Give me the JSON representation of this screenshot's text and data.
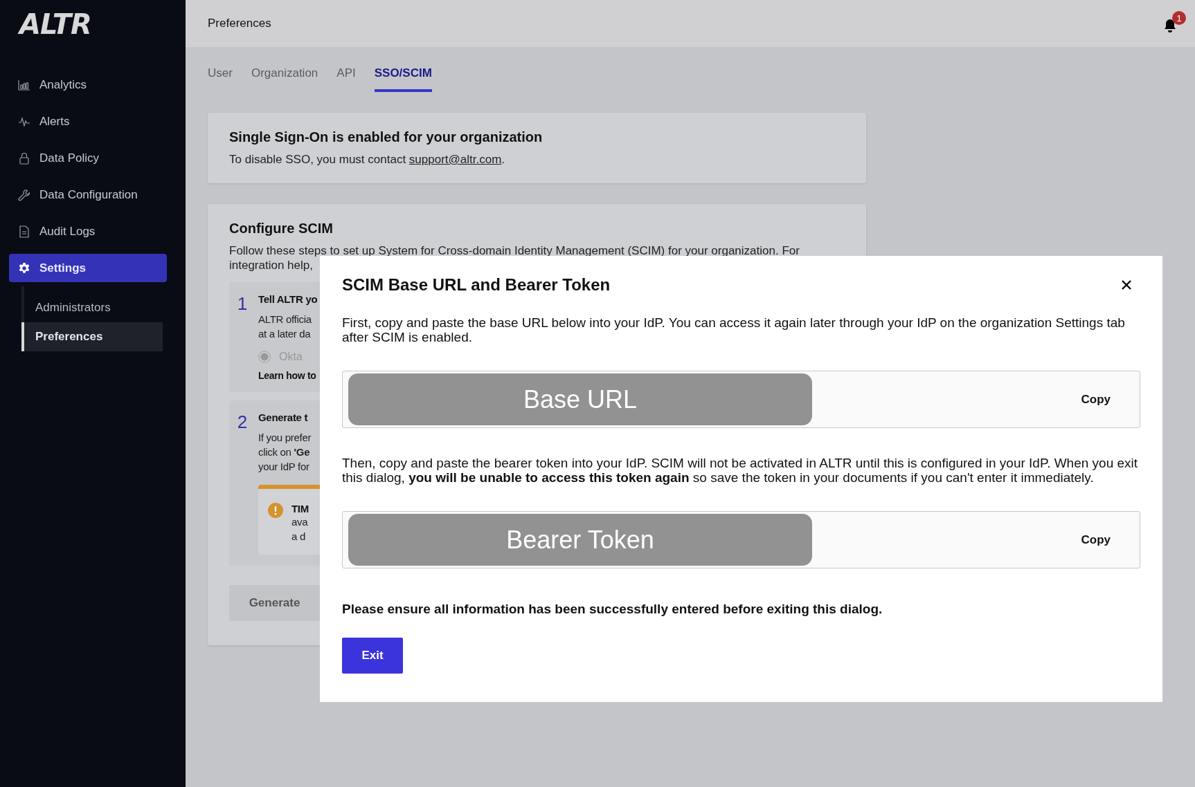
{
  "sidebar": {
    "logo": "ALTR",
    "items": [
      {
        "label": "Analytics",
        "selected": false
      },
      {
        "label": "Alerts",
        "selected": false
      },
      {
        "label": "Data Policy",
        "selected": false
      },
      {
        "label": "Data Configuration",
        "selected": false
      },
      {
        "label": "Audit Logs",
        "selected": false
      },
      {
        "label": "Settings",
        "selected": true,
        "children": [
          {
            "label": "Administrators",
            "selected": false
          },
          {
            "label": "Preferences",
            "selected": true
          }
        ]
      }
    ]
  },
  "header": {
    "title": "Preferences",
    "notification_count": "1"
  },
  "tabs": [
    {
      "label": "User",
      "selected": false
    },
    {
      "label": "Organization",
      "selected": false
    },
    {
      "label": "API",
      "selected": false
    },
    {
      "label": "SSO/SCIM",
      "selected": true
    }
  ],
  "sso_card": {
    "title": "Single Sign-On is enabled for your organization",
    "text_before": "To disable SSO, you must contact ",
    "link": "support@altr.com",
    "text_after": "."
  },
  "scim_card": {
    "title": "Configure SCIM",
    "intro": [
      "Follow these steps to set up System for Cross-domain Identity Management (SCIM) for your organization. For",
      "integration help,"
    ],
    "steps": [
      {
        "number": "1",
        "title": "Tell ALTR yo",
        "lines": [
          "ALTR officia",
          "at a later da"
        ],
        "option": {
          "label": "Okta",
          "selected": true,
          "disabled": true
        },
        "link": "Learn how to"
      },
      {
        "number": "2",
        "title": "Generate t",
        "lines": [
          "If you prefer",
          "click on **'Ge**",
          "your IdP for"
        ],
        "alert": {
          "title": "TIM",
          "lines": [
            "ava",
            "a d"
          ]
        }
      }
    ],
    "generate_button": "Generate"
  },
  "modal": {
    "title": "SCIM Base URL and Bearer Token",
    "intro": "First, copy and paste the base URL below into your IdP. You can access it again later through your IdP on the organization Settings tab after SCIM is enabled.",
    "fields": [
      {
        "value": "Base URL",
        "action": "Copy"
      },
      {
        "value": "Bearer Token",
        "action": "Copy"
      }
    ],
    "warning": "Then, copy and paste the bearer token into your IdP. SCIM will not be activated in ALTR until this is configured in your IdP. When you exit this dialog, **you will be unable to access this token again** so save the token in your documents if you can't enter it immediately.",
    "note": "Please ensure all information has been successfully entered before exiting this dialog.",
    "exit_button": "Exit"
  }
}
